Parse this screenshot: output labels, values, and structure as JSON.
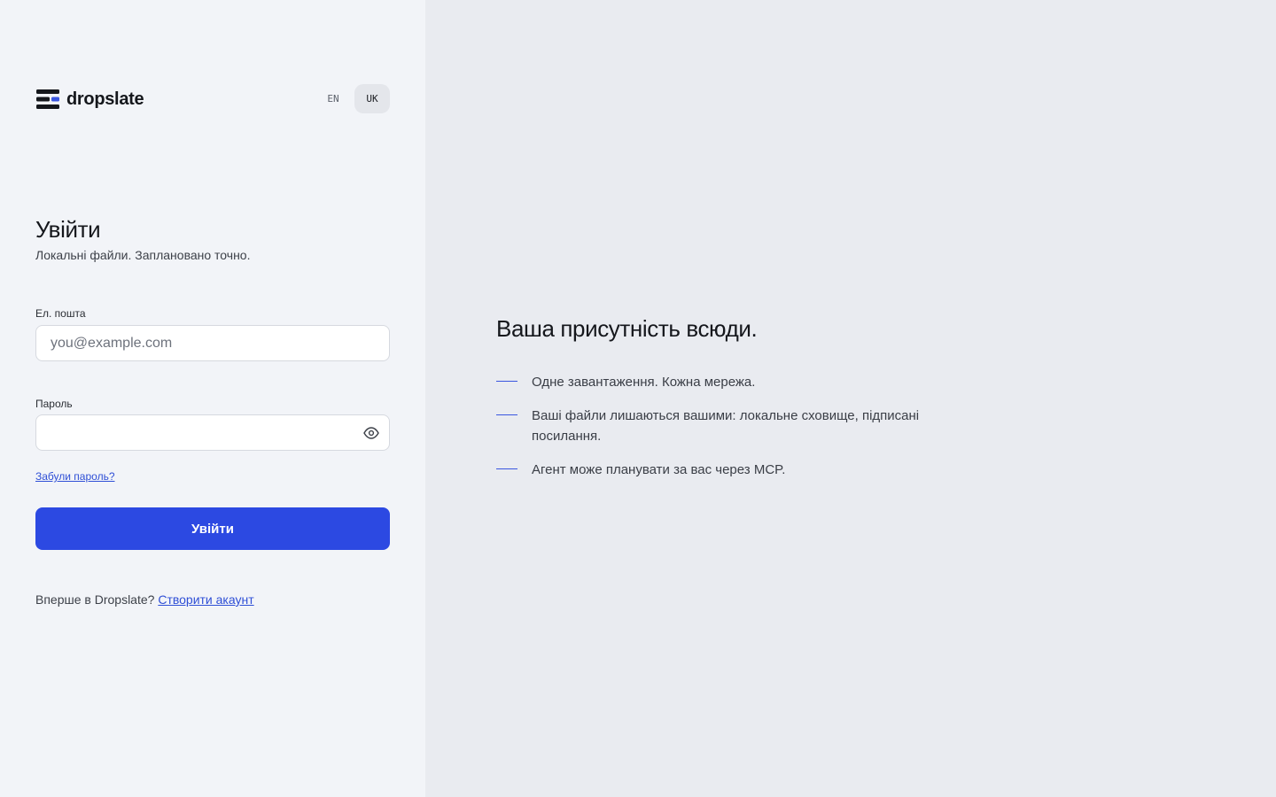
{
  "brand": {
    "name": "dropslate",
    "logo_icon": "stacked-bars-logo-icon"
  },
  "language": {
    "options": [
      "EN",
      "UK"
    ],
    "selected": "UK"
  },
  "login": {
    "title": "Увійти",
    "subtitle": "Локальні файли. Заплановано точно.",
    "email": {
      "label": "Ел. пошта",
      "placeholder": "you@example.com",
      "value": ""
    },
    "password": {
      "label": "Пароль",
      "value": "",
      "toggle_icon": "eye-icon"
    },
    "forgot_link": "Забули пароль?",
    "submit_label": "Увійти",
    "signup_prompt": "Вперше в Dropslate?",
    "signup_link": "Створити акаунт"
  },
  "promo": {
    "tagline": "Ваша присутність всюди.",
    "features": [
      "Одне завантаження. Кожна мережа.",
      "Ваші файли лишаються вашими: локальне сховище, підписані посилання.",
      "Агент може планувати за вас через MCP."
    ]
  },
  "colors": {
    "accent": "#2c49e2",
    "left_bg": "#f2f4f8",
    "right_bg": "#e9ebf0"
  }
}
